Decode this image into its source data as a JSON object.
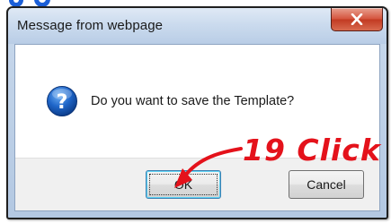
{
  "dialog": {
    "title": "Message from webpage",
    "close_icon": "close-x-icon",
    "message_icon": "question-icon",
    "message": "Do you want to save the Template?",
    "buttons": {
      "ok_label": "OK",
      "cancel_label": "Cancel"
    }
  },
  "annotation": {
    "step_label": "19  Click",
    "arrow_icon": "curved-arrow-icon",
    "color": "#e4121b"
  },
  "colors": {
    "close_button": "#c23a22",
    "titlebar": "#cbdbee",
    "ok_focus": "#3c7fb1"
  }
}
